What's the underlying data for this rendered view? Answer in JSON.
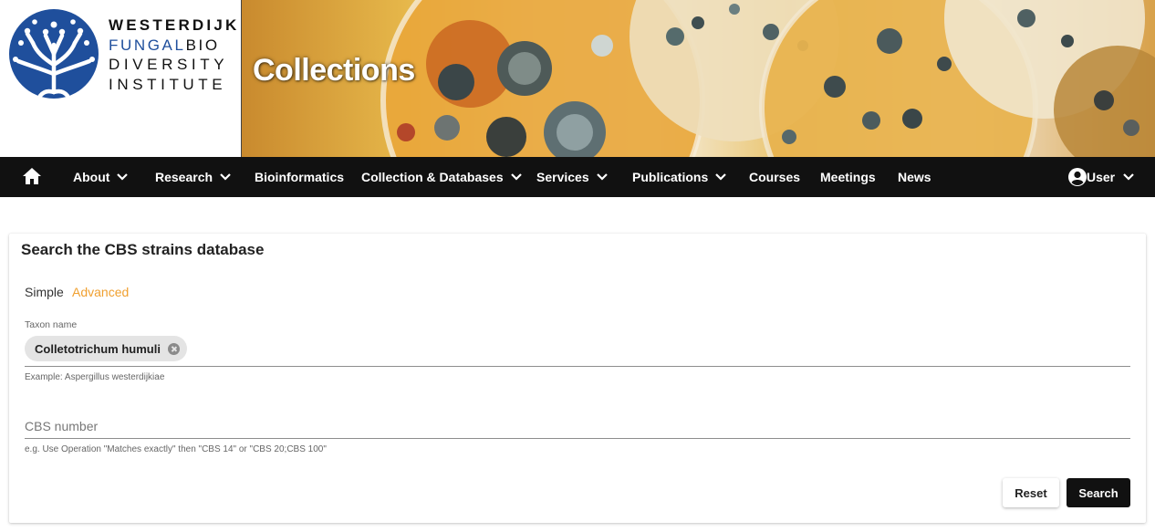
{
  "logo": {
    "line1": "WESTERDIJK",
    "line2_blue": "FUNGAL",
    "line2_dark": "BIO",
    "line3": "DIVERSITY",
    "line4": "INSTITUTE",
    "brand_blue": "#1f4f9c"
  },
  "banner": {
    "title": "Collections"
  },
  "nav": {
    "home_icon": "home-icon",
    "items": [
      {
        "label": "About",
        "dropdown": true
      },
      {
        "label": "Research",
        "dropdown": true
      },
      {
        "label": "Bioinformatics",
        "dropdown": false
      },
      {
        "label": "Collection & Databases",
        "dropdown": true
      },
      {
        "label": "Services",
        "dropdown": true
      },
      {
        "label": "Publications",
        "dropdown": true
      },
      {
        "label": "Courses",
        "dropdown": false
      },
      {
        "label": "Meetings",
        "dropdown": false
      },
      {
        "label": "News",
        "dropdown": false
      }
    ],
    "user_label": "User",
    "user_icon": "account-circle-icon"
  },
  "search": {
    "title": "Search the CBS strains database",
    "modes": {
      "simple": "Simple",
      "advanced": "Advanced"
    },
    "accent": "#f0a030",
    "taxon": {
      "label": "Taxon name",
      "chip_value": "Colletotrichum humuli",
      "helper": "Example: Aspergillus westerdijkiae"
    },
    "cbs": {
      "placeholder": "CBS number",
      "helper": "e.g. Use Operation \"Matches exactly\" then \"CBS 14\" or \"CBS 20;CBS 100\""
    },
    "buttons": {
      "reset": "Reset",
      "search": "Search"
    }
  }
}
